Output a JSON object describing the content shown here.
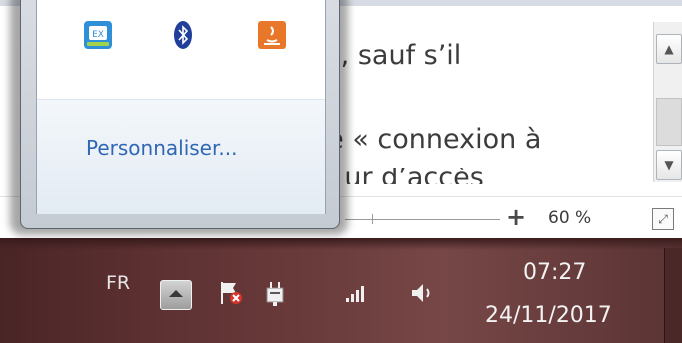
{
  "document": {
    "line1": "és, sauf s’il",
    "line2": "de « connexion à",
    "line3": "... ur d’accès"
  },
  "statusbar": {
    "zoom_plus": "+",
    "zoom_level": "60 %",
    "zoom_fraction": 0.6
  },
  "popup": {
    "icons": [
      "xml-tool-icon",
      "bluetooth-icon",
      "java-update-icon"
    ],
    "customize_label": "Personnaliser..."
  },
  "taskbar": {
    "language": "FR",
    "clock_time": "07:27",
    "clock_date": "24/11/2017",
    "tray_icons": [
      "show-hidden-icons-arrow",
      "action-center-flag-icon",
      "power-plug-icon",
      "network-signal-icon",
      "volume-icon"
    ]
  },
  "colors": {
    "link_blue": "#2f67b4",
    "taskbar_dark": "#4a2526",
    "taskbar_mid": "#774747",
    "popup_frame": "#c5cbd3"
  }
}
